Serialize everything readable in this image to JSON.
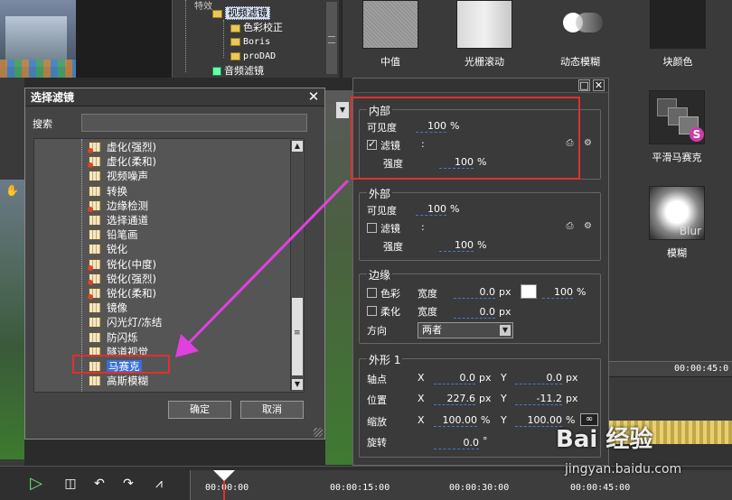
{
  "effects_tree": {
    "items": [
      {
        "label": "视频滤镜",
        "selected": true
      },
      {
        "label": "色彩校正"
      },
      {
        "label": "Boris"
      },
      {
        "label": "proDAD"
      },
      {
        "label": "音频滤镜"
      }
    ]
  },
  "effects_gallery": {
    "top": [
      "中值",
      "光栅滚动",
      "动态模糊",
      "块颜色"
    ],
    "side": [
      "平滑马赛克",
      "模糊"
    ],
    "blur_thumb_text": "Blur"
  },
  "dialog": {
    "title": "选择滤镜",
    "search_label": "搜索",
    "search_value": "",
    "filters": [
      {
        "label": "虚化(强烈)",
        "red": true
      },
      {
        "label": "虚化(柔和)",
        "red": true
      },
      {
        "label": "视频噪声",
        "red": false
      },
      {
        "label": "转换",
        "red": false
      },
      {
        "label": "边缘检测",
        "red": true
      },
      {
        "label": "选择通道",
        "red": false
      },
      {
        "label": "铅笔画",
        "red": false
      },
      {
        "label": "锐化",
        "red": false
      },
      {
        "label": "锐化(中度)",
        "red": true
      },
      {
        "label": "锐化(强烈)",
        "red": true
      },
      {
        "label": "锐化(柔和)",
        "red": true
      },
      {
        "label": "镜像",
        "red": false
      },
      {
        "label": "闪光灯/冻结",
        "red": false
      },
      {
        "label": "防闪烁",
        "red": false
      },
      {
        "label": "隧道视觉",
        "red": false
      },
      {
        "label": "马赛克",
        "red": false,
        "selected": true
      },
      {
        "label": "高斯模糊",
        "red": false
      }
    ],
    "ok_label": "确定",
    "cancel_label": "取消"
  },
  "props": {
    "inner": {
      "title": "内部",
      "visibility_label": "可见度",
      "visibility_value": "100",
      "visibility_unit": "%",
      "filter_label": "滤镜",
      "filter_checked": true,
      "filter_value": ":",
      "strength_label": "强度",
      "strength_value": "100",
      "strength_unit": "%"
    },
    "outer": {
      "title": "外部",
      "visibility_label": "可见度",
      "visibility_value": "100",
      "visibility_unit": "%",
      "filter_label": "滤镜",
      "filter_checked": false,
      "filter_value": ":",
      "strength_label": "强度",
      "strength_value": "100",
      "strength_unit": "%"
    },
    "edge": {
      "title": "边缘",
      "color_label": "色彩",
      "width_label": "宽度",
      "color_width_value": "0.0",
      "px": "px",
      "color_pct": "100",
      "pct_unit": "%",
      "soft_label": "柔化",
      "soft_width_value": "0.0",
      "direction_label": "方向",
      "direction_value": "两者",
      "swatch_color": "#ffffff"
    },
    "shape": {
      "title": "外形 1",
      "pivot_label": "轴点",
      "pivot_x": "0.0",
      "pivot_y": "0.0",
      "pos_label": "位置",
      "pos_x": "227.6",
      "pos_y": "-11.2",
      "scale_label": "缩放",
      "scale_x": "100.00",
      "scale_y": "100.00",
      "rotate_label": "旋转",
      "rotate_value": "0.0",
      "degree": "°",
      "x_label": "X",
      "y_label": "Y",
      "px": "px",
      "pct": "%"
    }
  },
  "timeline": {
    "right_tc": "00:00:45:0",
    "ticks": [
      "00:00:00",
      "00:00:15:00",
      "00:00:30:00",
      "00:00:45:00"
    ]
  },
  "watermark": {
    "logo": "Bai 经验",
    "url": "jingyan.baidu.com"
  },
  "colors": {
    "highlight_red": "#e03030",
    "arrow_magenta": "#e040e0",
    "selection_blue": "#3a6fd8"
  }
}
